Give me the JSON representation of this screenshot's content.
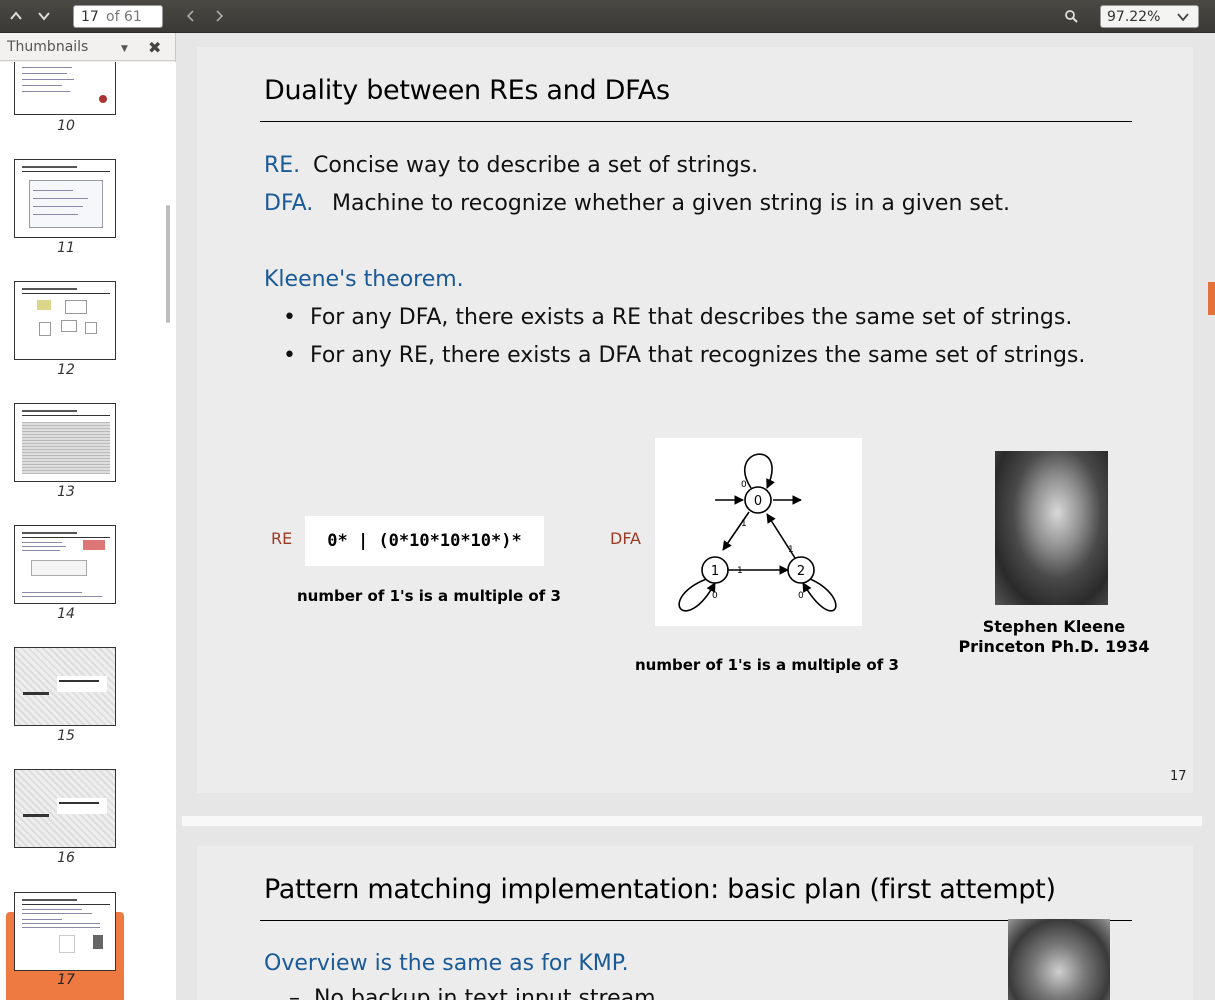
{
  "toolbar": {
    "page_current": "17",
    "page_total": "of 61",
    "zoom": "97.22%"
  },
  "sidebar": {
    "title": "Thumbnails",
    "thumbnails": [
      {
        "num": "10"
      },
      {
        "num": "11"
      },
      {
        "num": "12"
      },
      {
        "num": "13"
      },
      {
        "num": "14"
      },
      {
        "num": "15"
      },
      {
        "num": "16"
      },
      {
        "num": "17"
      }
    ]
  },
  "slide17": {
    "title": "Duality between REs and DFAs",
    "re_term": "RE.",
    "re_def": "Concise way to describe a set of strings.",
    "dfa_term": "DFA.",
    "dfa_def": "Machine to recognize whether a given string is in a given set.",
    "theorem": "Kleene's theorem.",
    "bullets": [
      "For any DFA, there exists a RE that describes the same set of strings.",
      "For any RE, there exists a DFA that recognizes the same set of strings."
    ],
    "re_label": "RE",
    "re_expression": "0*  |  (0*10*10*10*)*",
    "re_caption": "number of 1's is a multiple of 3",
    "dfa_label": "DFA",
    "dfa_caption": "number of 1's is a multiple of 3",
    "dfa_states": [
      "0",
      "1",
      "2"
    ],
    "dfa_edge_labels": [
      "0",
      "1",
      "1",
      "1",
      "0",
      "0"
    ],
    "photo_name": "Stephen Kleene",
    "photo_affil": "Princeton Ph.D. 1934",
    "page_number": "17"
  },
  "slide18": {
    "title": "Pattern matching implementation:  basic plan (first attempt)",
    "overview": "Overview is the same as for KMP.",
    "cutoff_text": "No backup in text input stream."
  },
  "colors": {
    "accent_blue": "#1a5a96",
    "label_red": "#9c3a24",
    "selection_orange": "#ee7a41"
  }
}
